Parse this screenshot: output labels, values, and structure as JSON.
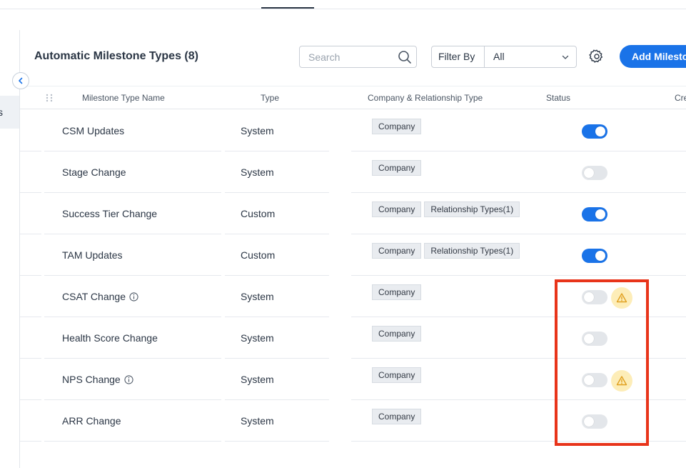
{
  "page": {
    "title": "Automatic Milestone Types (8)",
    "left_nav_partial_label": "s"
  },
  "toolbar": {
    "search_placeholder": "Search",
    "filter_label": "Filter By",
    "filter_value": "All",
    "add_button_label": "Add Milestone Type"
  },
  "table": {
    "headers": {
      "name": "Milestone Type Name",
      "type": "Type",
      "company_relationship": "Company & Relationship Type",
      "status": "Status",
      "created": "Created"
    },
    "rows": [
      {
        "name": "CSM Updates",
        "type": "System",
        "chips": [
          "Company"
        ],
        "status_on": true,
        "info_icon": false,
        "warning_icon": false
      },
      {
        "name": "Stage Change",
        "type": "System",
        "chips": [
          "Company"
        ],
        "status_on": false,
        "info_icon": false,
        "warning_icon": false
      },
      {
        "name": "Success Tier Change",
        "type": "Custom",
        "chips": [
          "Company",
          "Relationship Types(1)"
        ],
        "status_on": true,
        "info_icon": false,
        "warning_icon": false
      },
      {
        "name": "TAM Updates",
        "type": "Custom",
        "chips": [
          "Company",
          "Relationship Types(1)"
        ],
        "status_on": true,
        "info_icon": false,
        "warning_icon": false
      },
      {
        "name": "CSAT Change",
        "type": "System",
        "chips": [
          "Company"
        ],
        "status_on": false,
        "info_icon": true,
        "warning_icon": true
      },
      {
        "name": "Health Score Change",
        "type": "System",
        "chips": [
          "Company"
        ],
        "status_on": false,
        "info_icon": false,
        "warning_icon": false
      },
      {
        "name": "NPS Change",
        "type": "System",
        "chips": [
          "Company"
        ],
        "status_on": false,
        "info_icon": true,
        "warning_icon": true
      },
      {
        "name": "ARR Change",
        "type": "System",
        "chips": [
          "Company"
        ],
        "status_on": false,
        "info_icon": false,
        "warning_icon": false
      }
    ]
  },
  "colors": {
    "accent": "#1a73e8",
    "toggle_off": "#e3e6ea",
    "warning_bg": "#fdedb8",
    "warning_icon": "#e0a020",
    "highlight": "#e8341a"
  },
  "icons": {
    "search": "search-icon",
    "settings": "gear-icon",
    "collapse": "chevron-left-icon",
    "dropdown": "chevron-down-icon",
    "drag": "drag-handle-icon",
    "info": "info-icon",
    "warning": "warning-triangle-icon"
  }
}
